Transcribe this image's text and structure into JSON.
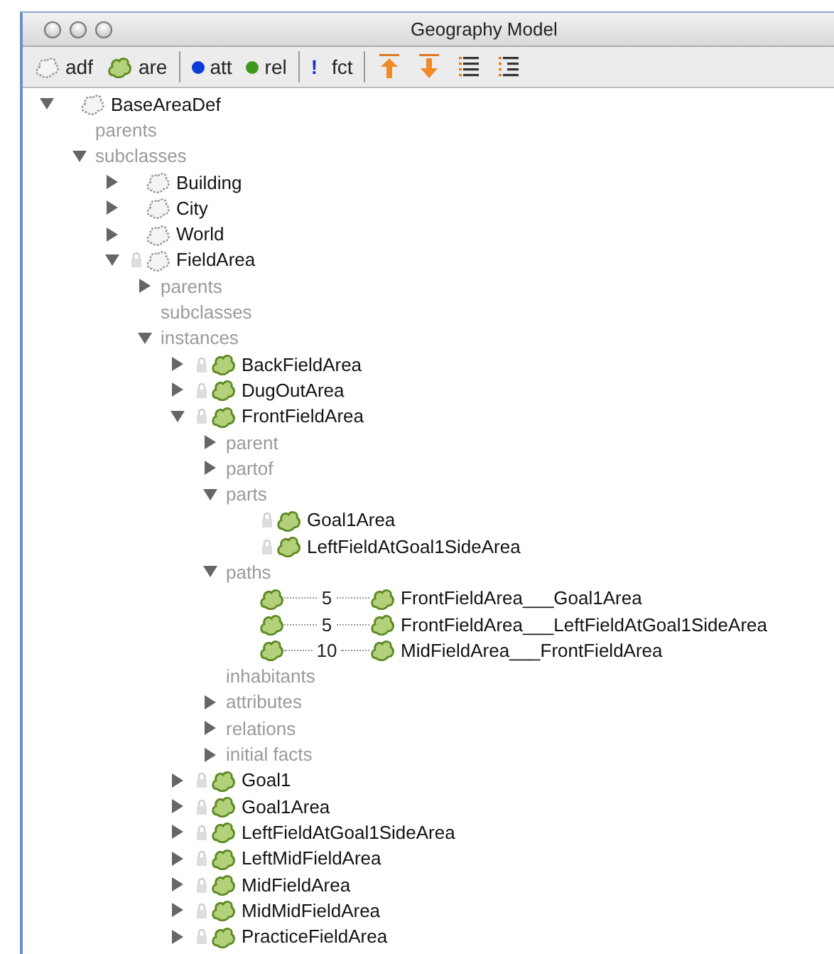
{
  "window": {
    "title": "Geography Model"
  },
  "toolbar": {
    "groups": [
      [
        {
          "kind": "class",
          "label": "adf"
        },
        {
          "kind": "area",
          "label": "are"
        }
      ],
      [
        {
          "kind": "attribute",
          "label": "att"
        },
        {
          "kind": "relation",
          "label": "rel"
        }
      ],
      [
        {
          "kind": "fact",
          "icon": "!",
          "label": "fct"
        }
      ],
      [
        {
          "kind": "move-top"
        },
        {
          "kind": "move-bottom"
        },
        {
          "kind": "list"
        },
        {
          "kind": "list-indent"
        }
      ]
    ]
  },
  "tree": [
    {
      "label": "BaseAreaDef",
      "kind": "class",
      "expanded": true,
      "children": [
        {
          "label": "parents",
          "kind": "category"
        },
        {
          "label": "subclasses",
          "kind": "category",
          "expanded": true,
          "children": [
            {
              "label": "Building",
              "kind": "class",
              "expanded": false
            },
            {
              "label": "City",
              "kind": "class",
              "expanded": false
            },
            {
              "label": "World",
              "kind": "class",
              "expanded": false
            },
            {
              "label": "FieldArea",
              "kind": "class",
              "locked": true,
              "expanded": true,
              "children": [
                {
                  "label": "parents",
                  "kind": "category",
                  "expanded": false
                },
                {
                  "label": "subclasses",
                  "kind": "category"
                },
                {
                  "label": "instances",
                  "kind": "category",
                  "expanded": true,
                  "children": [
                    {
                      "label": "BackFieldArea",
                      "kind": "instance",
                      "locked": true,
                      "expanded": false
                    },
                    {
                      "label": "DugOutArea",
                      "kind": "instance",
                      "locked": true,
                      "expanded": false
                    },
                    {
                      "label": "FrontFieldArea",
                      "kind": "instance",
                      "locked": true,
                      "expanded": true,
                      "children": [
                        {
                          "label": "parent",
                          "kind": "category",
                          "expanded": false
                        },
                        {
                          "label": "partof",
                          "kind": "category",
                          "expanded": false
                        },
                        {
                          "label": "parts",
                          "kind": "category",
                          "expanded": true,
                          "children": [
                            {
                              "label": "Goal1Area",
                              "kind": "instance",
                              "locked": true
                            },
                            {
                              "label": "LeftFieldAtGoal1SideArea",
                              "kind": "instance",
                              "locked": true
                            }
                          ]
                        },
                        {
                          "label": "paths",
                          "kind": "category",
                          "expanded": true,
                          "children": [
                            {
                              "label": "FrontFieldArea___Goal1Area",
                              "kind": "path",
                              "weight": "5"
                            },
                            {
                              "label": "FrontFieldArea___LeftFieldAtGoal1SideArea",
                              "kind": "path",
                              "weight": "5"
                            },
                            {
                              "label": "MidFieldArea___FrontFieldArea",
                              "kind": "path",
                              "weight": "10"
                            }
                          ]
                        },
                        {
                          "label": "inhabitants",
                          "kind": "category"
                        },
                        {
                          "label": "attributes",
                          "kind": "category",
                          "expanded": false
                        },
                        {
                          "label": "relations",
                          "kind": "category",
                          "expanded": false
                        },
                        {
                          "label": "initial facts",
                          "kind": "category",
                          "expanded": false
                        }
                      ]
                    },
                    {
                      "label": "Goal1",
                      "kind": "instance",
                      "locked": true,
                      "expanded": false
                    },
                    {
                      "label": "Goal1Area",
                      "kind": "instance",
                      "locked": true,
                      "expanded": false
                    },
                    {
                      "label": "LeftFieldAtGoal1SideArea",
                      "kind": "instance",
                      "locked": true,
                      "expanded": false
                    },
                    {
                      "label": "LeftMidFieldArea",
                      "kind": "instance",
                      "locked": true,
                      "expanded": false
                    },
                    {
                      "label": "MidFieldArea",
                      "kind": "instance",
                      "locked": true,
                      "expanded": false
                    },
                    {
                      "label": "MidMidFieldArea",
                      "kind": "instance",
                      "locked": true,
                      "expanded": false
                    },
                    {
                      "label": "PracticeFieldArea",
                      "kind": "instance",
                      "locked": true,
                      "expanded": false
                    }
                  ]
                }
              ]
            }
          ]
        }
      ]
    }
  ]
}
